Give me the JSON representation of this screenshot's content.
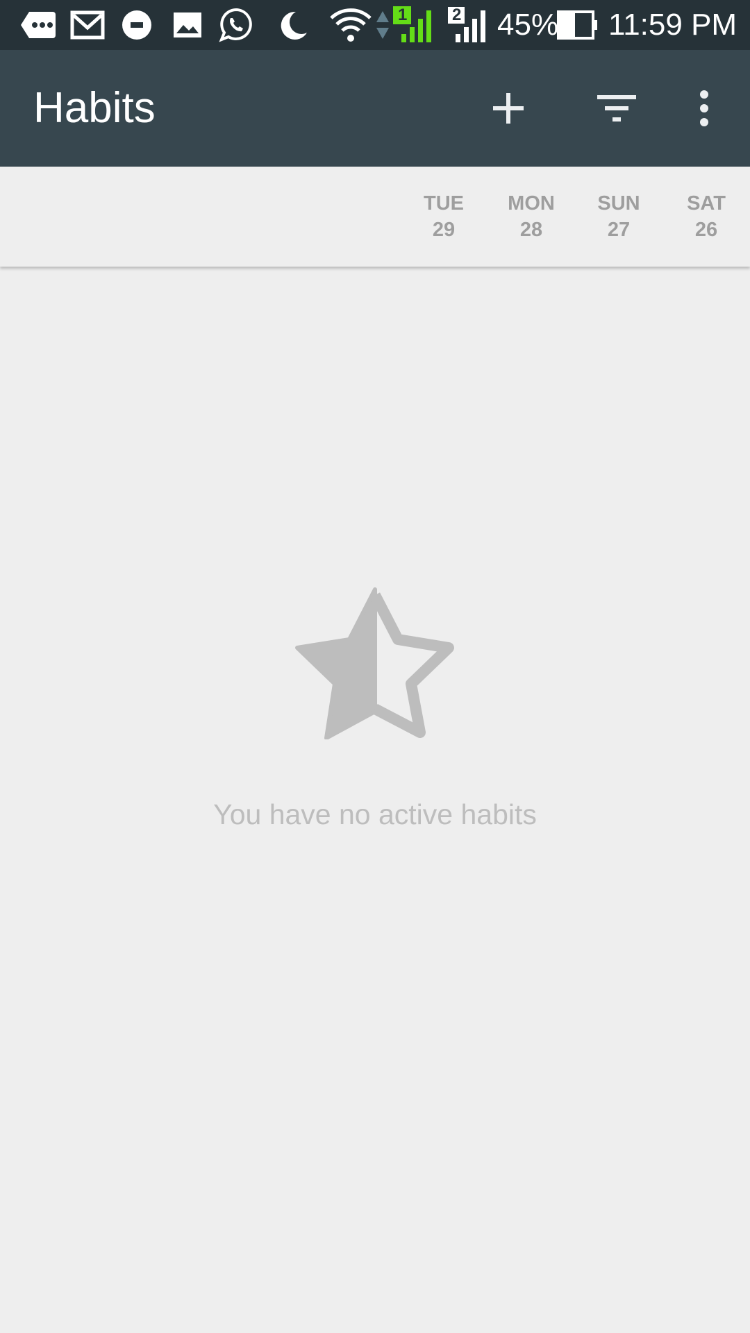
{
  "status_bar": {
    "battery_percent": "45%",
    "time": "11:59 PM",
    "sim1_label": "1",
    "sim2_label": "2",
    "icons": [
      "message-icon",
      "gmail-icon",
      "uber-icon",
      "gallery-icon",
      "whatsapp-icon",
      "moon-icon",
      "wifi-icon",
      "signal-sim1-icon",
      "signal-sim2-icon",
      "battery-icon"
    ],
    "background": "#263238"
  },
  "toolbar": {
    "title": "Habits",
    "actions": [
      "add-icon",
      "filter-icon",
      "more-vert-icon"
    ],
    "background": "#37474f"
  },
  "day_header": {
    "days": [
      {
        "weekday": "TUE",
        "date": "29"
      },
      {
        "weekday": "MON",
        "date": "28"
      },
      {
        "weekday": "SUN",
        "date": "27"
      },
      {
        "weekday": "SAT",
        "date": "26"
      }
    ]
  },
  "empty_state": {
    "icon": "half-star-icon",
    "message": "You have no active habits"
  },
  "colors": {
    "background": "#eeeeee",
    "muted_text": "#9e9e9e",
    "empty_gray": "#bdbdbd",
    "sim1_green": "#64dd17"
  }
}
